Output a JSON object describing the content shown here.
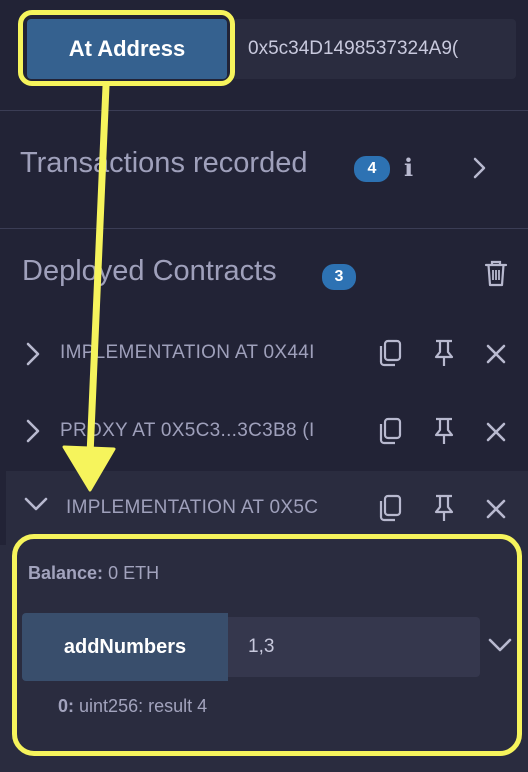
{
  "top": {
    "at_address_label": "At Address",
    "address_value": "0x5c34D1498537324A9("
  },
  "transactions": {
    "title": "Transactions recorded",
    "count": "4",
    "info_glyph": "i",
    "arrow_glyph": "›"
  },
  "deployed": {
    "title": "Deployed Contracts",
    "count": "3",
    "contracts": [
      {
        "label": "IMPLEMENTATION AT 0X44I"
      },
      {
        "label": "PROXY AT 0X5C3...3C3B8 (I"
      },
      {
        "label": "IMPLEMENTATION AT 0X5C"
      }
    ]
  },
  "panel": {
    "balance_label": "Balance:",
    "balance_value": "0 ETH",
    "function_label": "addNumbers",
    "function_input": "1,3",
    "result_index": "0:",
    "result_text": "uint256: result 4"
  },
  "icons": {
    "copy": "copy-icon",
    "pin": "pin-icon",
    "close": "close-icon",
    "trash": "trash-icon",
    "chevron_right": "chevron-right-icon",
    "chevron_down": "chevron-down-icon"
  },
  "colors": {
    "background": "#222336",
    "button_primary": "#35618f",
    "badge": "#2d72b3",
    "annotation": "#f6f45c"
  }
}
